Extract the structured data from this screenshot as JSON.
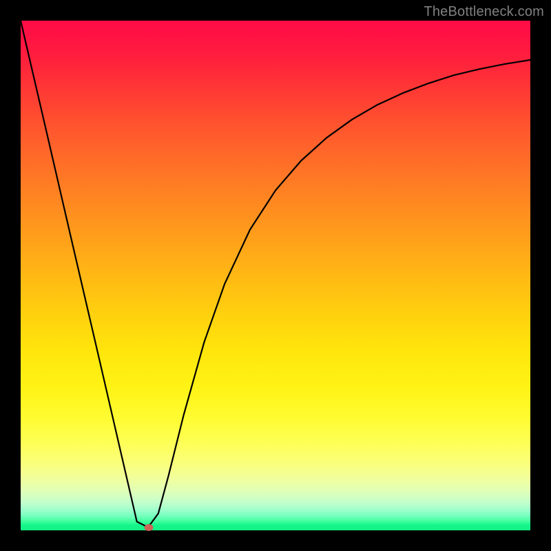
{
  "watermark": "TheBottleneck.com",
  "marker": {
    "x_frac": 0.2516,
    "y_frac": 0.9946
  },
  "colors": {
    "frame": "#000000",
    "watermark_text": "#808080",
    "marker_fill": "#cc6356",
    "curve_stroke": "#000000"
  },
  "chart_data": {
    "type": "line",
    "title": "",
    "xlabel": "",
    "ylabel": "",
    "xlim": [
      0,
      1
    ],
    "ylim": [
      0,
      100
    ],
    "series": [
      {
        "name": "curve",
        "x": [
          0.0,
          0.05,
          0.1,
          0.15,
          0.2,
          0.228,
          0.25,
          0.27,
          0.29,
          0.32,
          0.36,
          0.4,
          0.45,
          0.5,
          0.55,
          0.6,
          0.65,
          0.7,
          0.75,
          0.8,
          0.85,
          0.9,
          0.95,
          1.0
        ],
        "y": [
          100.0,
          78.5,
          56.9,
          35.4,
          13.8,
          1.7,
          0.6,
          3.3,
          10.7,
          22.7,
          36.9,
          48.3,
          59.0,
          66.7,
          72.5,
          77.0,
          80.6,
          83.5,
          85.8,
          87.7,
          89.3,
          90.5,
          91.5,
          92.3
        ]
      }
    ],
    "marker": {
      "x": 0.2516,
      "y": 0.54
    },
    "gradient_stops": [
      [
        "0%",
        "#ff0b46"
      ],
      [
        "50%",
        "#ffb814"
      ],
      [
        "83%",
        "#feff57"
      ],
      [
        "96%",
        "#9effcd"
      ],
      [
        "100%",
        "#14f284"
      ]
    ]
  }
}
